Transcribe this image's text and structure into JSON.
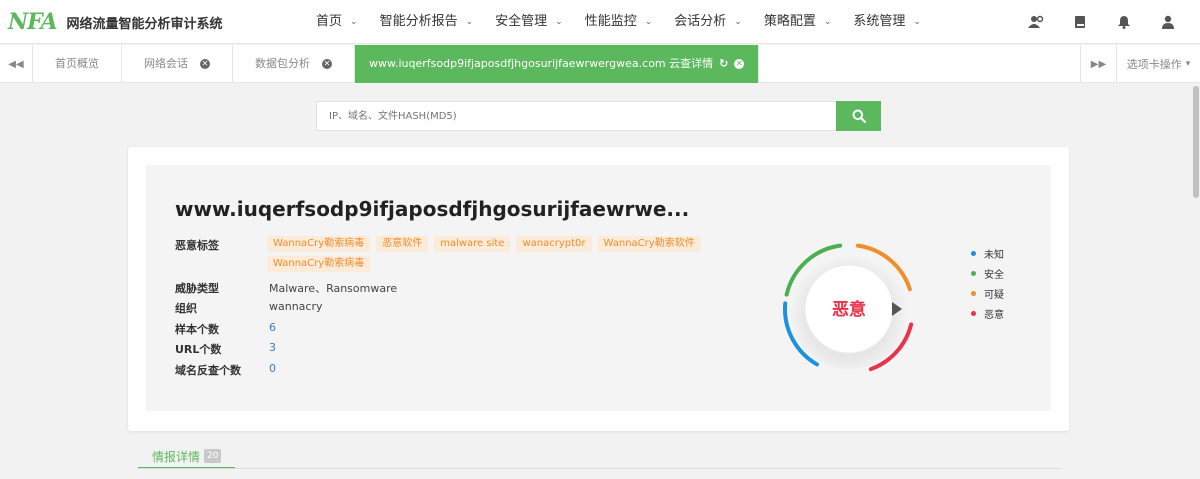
{
  "app": {
    "logo_text": "NFA",
    "title": "网络流量智能分析审计系统"
  },
  "nav": {
    "items": [
      {
        "label": "首页",
        "has_dropdown": true
      },
      {
        "label": "智能分析报告",
        "has_dropdown": true
      },
      {
        "label": "安全管理",
        "has_dropdown": true
      },
      {
        "label": "性能监控",
        "has_dropdown": true
      },
      {
        "label": "会话分析",
        "has_dropdown": true
      },
      {
        "label": "策略配置",
        "has_dropdown": true
      },
      {
        "label": "系统管理",
        "has_dropdown": true
      }
    ],
    "caret": "⌄",
    "icons": [
      "user-settings-icon",
      "book-icon",
      "bell-icon",
      "user-icon"
    ]
  },
  "tabs": {
    "prev_icon": "double-chevron-left-icon",
    "items": [
      {
        "label": "首页概览",
        "closable": false,
        "active": false
      },
      {
        "label": "网络会话",
        "closable": true,
        "active": false
      },
      {
        "label": "数据包分析",
        "closable": true,
        "active": false
      },
      {
        "label": "www.iuqerfsodp9ifjaposdfjhgosurijfaewrwergwea.com 云查详情",
        "closable": true,
        "active": true
      }
    ],
    "close_glyph": "✕",
    "refresh_glyph": "↻",
    "next_icon": "double-chevron-right-icon",
    "ops_label": "选项卡操作",
    "ops_caret": "▾"
  },
  "search": {
    "placeholder": "IP、域名、文件HASH(MD5)",
    "value": "",
    "button_icon": "search-icon"
  },
  "detail": {
    "domain": "www.iuqerfsodp9ifjaposdfjhgosurijfaewrwe...",
    "labels": {
      "tags": "恶意标签",
      "threat_type": "威胁类型",
      "organization": "组织",
      "sample_count": "样本个数",
      "url_count": "URL个数",
      "reverse_domain_count": "域名反查个数"
    },
    "tags": [
      "WannaCry勒索病毒",
      "恶意软件",
      "malware site",
      "wanacrypt0r",
      "WannaCry勒索软件",
      "WannaCry勒索病毒"
    ],
    "threat_type": "Malware、Ransomware",
    "organization": "wannacry",
    "sample_count": "6",
    "url_count": "3",
    "reverse_domain_count": "0"
  },
  "gauge": {
    "verdict": "恶意",
    "verdict_color": "#e8334a",
    "segments": [
      {
        "name": "未知",
        "color": "#1e90e0"
      },
      {
        "name": "安全",
        "color": "#4caf50"
      },
      {
        "name": "可疑",
        "color": "#f28d2c"
      },
      {
        "name": "恶意",
        "color": "#e8334a"
      }
    ]
  },
  "legend": [
    {
      "label": "未知",
      "color": "#1e90e0"
    },
    {
      "label": "安全",
      "color": "#4caf50"
    },
    {
      "label": "可疑",
      "color": "#f28d2c"
    },
    {
      "label": "恶意",
      "color": "#e8334a"
    }
  ],
  "section": {
    "tab_label": "情报详情",
    "count": "20"
  },
  "colors": {
    "accent": "#5cb85c",
    "tag_bg": "#fdebd9",
    "tag_text": "#f28d2c",
    "link": "#3a7bd5"
  }
}
